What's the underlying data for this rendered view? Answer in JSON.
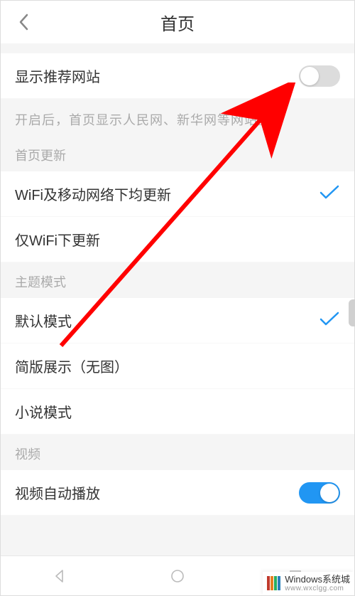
{
  "header": {
    "title": "首页"
  },
  "recommend": {
    "label": "显示推荐网站",
    "hint": "开启后，首页显示人民网、新华网等网站。",
    "enabled": false
  },
  "updateSection": {
    "title": "首页更新",
    "options": [
      {
        "label": "WiFi及移动网络下均更新",
        "selected": true
      },
      {
        "label": "仅WiFi下更新",
        "selected": false
      }
    ]
  },
  "themeSection": {
    "title": "主题模式",
    "options": [
      {
        "label": "默认模式",
        "selected": true
      },
      {
        "label": "简版展示（无图）",
        "selected": false
      },
      {
        "label": "小说模式",
        "selected": false
      }
    ]
  },
  "videoSection": {
    "title": "视频",
    "autoplay": {
      "label": "视频自动播放",
      "enabled": true
    }
  },
  "highlight": {
    "color": "#ff0000"
  },
  "watermark": {
    "brand": "Windows系统城",
    "url": "www.wxclgg.com"
  }
}
